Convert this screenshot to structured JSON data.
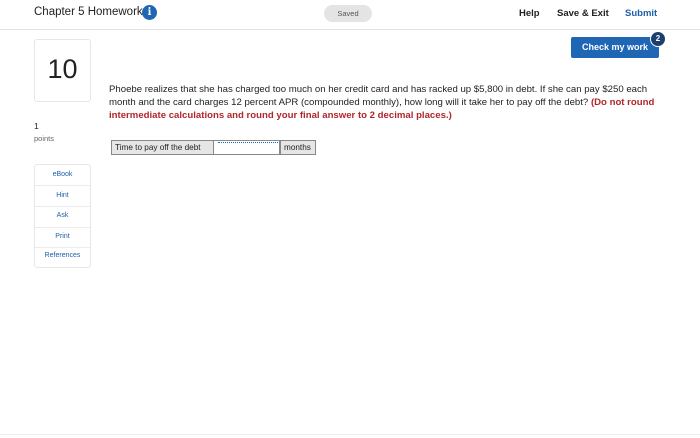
{
  "header": {
    "title": "Chapter 5 Homework",
    "info_icon": "i",
    "saved_label": "Saved",
    "help_label": "Help",
    "save_exit_label": "Save & Exit",
    "submit_label": "Submit"
  },
  "check": {
    "label": "Check my work",
    "badge": "2"
  },
  "question": {
    "number": "10",
    "points_value": "1",
    "points_label": "points",
    "text": "Phoebe realizes that she has charged too much on her credit card and has racked up $5,800 in debt. If she can pay $250 each month and the card charges 12 percent APR (compounded monthly), how long will it take her to pay off the debt?",
    "instruction": "(Do not round intermediate calculations and round your final answer to 2 decimal places.)"
  },
  "answer": {
    "label": "Time to pay off the debt",
    "value": "",
    "unit": "months"
  },
  "side_links": [
    "eBook",
    "Hint",
    "Ask",
    "Print",
    "References"
  ],
  "colors": {
    "accent": "#1f66b5",
    "instruction_red": "#b0262a",
    "badge_dark": "#1b3f6e"
  }
}
